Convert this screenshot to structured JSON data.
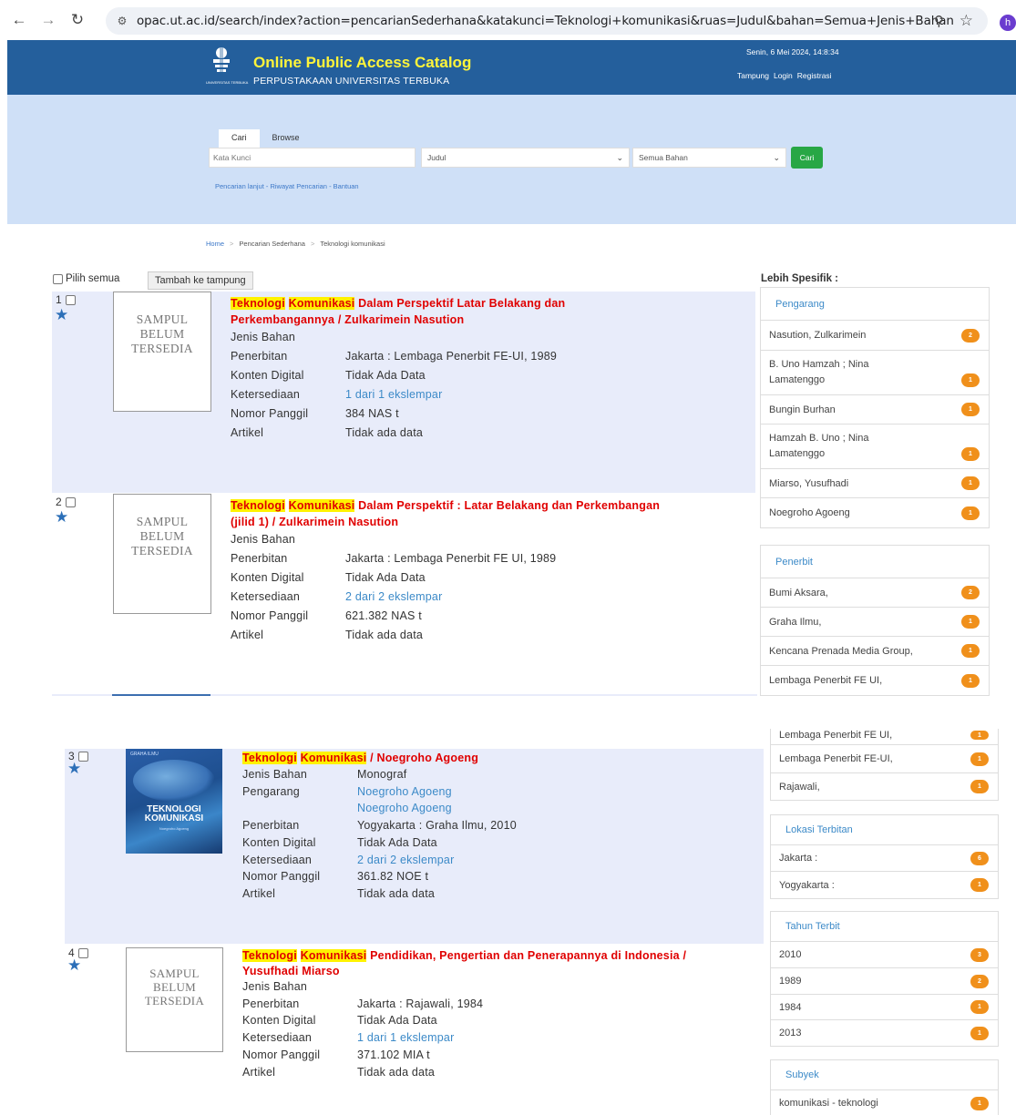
{
  "browser": {
    "url": "opac.ut.ac.id/search/index?action=pencarianSederhana&katakunci=Teknologi+komunikasi&ruas=Judul&bahan=Semua+Jenis+Bahan",
    "profile_initial": "h"
  },
  "header": {
    "title": "Online Public Access Catalog",
    "subtitle": "PERPUSTAKAAN UNIVERSITAS TERBUKA",
    "logo_text": "UNIVERSITAS TERBUKA",
    "date": "Senin, 6 Mei 2024, 14:8:34",
    "links": [
      "Tampung",
      "Login",
      "Registrasi"
    ]
  },
  "search": {
    "tabs": [
      "Cari",
      "Browse"
    ],
    "keyword_placeholder": "Kata Kunci",
    "field_value": "Judul",
    "material_value": "Semua Bahan",
    "button": "Cari",
    "links": "Pencarian lanjut - Riwayat Pencarian - Bantuan"
  },
  "breadcrumb": [
    "Home",
    "Pencarian Sederhana",
    "Teknologi komunikasi"
  ],
  "toolbar": {
    "select_all": "Pilih semua",
    "add_button": "Tambah ke tampung"
  },
  "placeholder_cover": [
    "SAMPUL",
    "BELUM",
    "TERSEDIA"
  ],
  "results": [
    {
      "num": "1",
      "title_hl1": "Teknologi",
      "title_hl2": "Komunikasi",
      "title_rest": "Dalam Perspektif Latar Belakang dan Perkembangannya / Zulkarimein Nasution",
      "fields": [
        {
          "k": "Jenis Bahan",
          "v": ""
        },
        {
          "k": "Penerbitan",
          "v": "Jakarta : Lembaga Penerbit FE-UI, 1989"
        },
        {
          "k": "Konten Digital",
          "v": "Tidak Ada Data"
        },
        {
          "k": "Ketersediaan",
          "v": "1 dari 1 ekslempar"
        },
        {
          "k": "Nomor Panggil",
          "v": "384 NAS t"
        },
        {
          "k": "Artikel",
          "v": "Tidak ada data"
        }
      ]
    },
    {
      "num": "2",
      "title_hl1": "Teknologi",
      "title_hl2": "Komunikasi",
      "title_rest": "Dalam Perspektif : Latar Belakang dan Perkembangan (jilid 1) / Zulkarimein Nasution",
      "fields": [
        {
          "k": "Jenis Bahan",
          "v": ""
        },
        {
          "k": "Penerbitan",
          "v": "Jakarta : Lembaga Penerbit FE UI, 1989"
        },
        {
          "k": "Konten Digital",
          "v": "Tidak Ada Data"
        },
        {
          "k": "Ketersediaan",
          "v": "2 dari 2 ekslempar"
        },
        {
          "k": "Nomor Panggil",
          "v": "621.382 NAS t"
        },
        {
          "k": "Artikel",
          "v": "Tidak ada data"
        }
      ]
    },
    {
      "num": "3",
      "title_hl1": "Teknologi",
      "title_hl2": "Komunikasi",
      "title_rest": "/ Noegroho Agoeng",
      "cover": {
        "publisher": "GRAHA ILMU",
        "title_line1": "TEKNOLOGI",
        "title_line2": "KOMUNIKASI",
        "author": "Noegroho Agoeng"
      },
      "fields": [
        {
          "k": "Jenis Bahan",
          "v": "Monograf"
        },
        {
          "k": "Pengarang",
          "v": "Noegroho Agoeng"
        },
        {
          "k": "",
          "v": "Noegroho Agoeng"
        },
        {
          "k": "Penerbitan",
          "v": "Yogyakarta : Graha Ilmu, 2010"
        },
        {
          "k": "Konten Digital",
          "v": "Tidak Ada Data"
        },
        {
          "k": "Ketersediaan",
          "v": "2 dari 2 ekslempar"
        },
        {
          "k": "Nomor Panggil",
          "v": "361.82 NOE t"
        },
        {
          "k": "Artikel",
          "v": "Tidak ada data"
        }
      ]
    },
    {
      "num": "4",
      "title_hl1": "Teknologi",
      "title_hl2": "Komunikasi",
      "title_rest": "Pendidikan, Pengertian dan Penerapannya di Indonesia / Yusufhadi Miarso",
      "fields": [
        {
          "k": "Jenis Bahan",
          "v": ""
        },
        {
          "k": "Penerbitan",
          "v": "Jakarta : Rajawali, 1984"
        },
        {
          "k": "Konten Digital",
          "v": "Tidak Ada Data"
        },
        {
          "k": "Ketersediaan",
          "v": "1 dari 1 ekslempar"
        },
        {
          "k": "Nomor Panggil",
          "v": "371.102 MIA t"
        },
        {
          "k": "Artikel",
          "v": "Tidak ada data"
        }
      ]
    }
  ],
  "sidebar": {
    "heading": "Lebih Spesifik :",
    "pengarang": {
      "title": "Pengarang",
      "items": [
        {
          "label": "Nasution, Zulkarimein",
          "count": "2"
        },
        {
          "label": "B. Uno Hamzah ; Nina Lamatenggo",
          "count": "1"
        },
        {
          "label": "Bungin Burhan",
          "count": "1"
        },
        {
          "label": "Hamzah B. Uno ; Nina Lamatenggo",
          "count": "1"
        },
        {
          "label": "Miarso, Yusufhadi",
          "count": "1"
        },
        {
          "label": "Noegroho Agoeng",
          "count": "1"
        }
      ]
    },
    "penerbit": {
      "title": "Penerbit",
      "items": [
        {
          "label": "Bumi Aksara,",
          "count": "2"
        },
        {
          "label": "Graha Ilmu,",
          "count": "1"
        },
        {
          "label": "Kencana Prenada Media Group,",
          "count": "1"
        },
        {
          "label": "Lembaga Penerbit FE UI,",
          "count": "1"
        }
      ],
      "items_cont": [
        {
          "label": "Lembaga Penerbit FE UI,",
          "count": "1"
        },
        {
          "label": "Lembaga Penerbit FE-UI,",
          "count": "1"
        },
        {
          "label": "Rajawali,",
          "count": "1"
        }
      ]
    },
    "lokasi": {
      "title": "Lokasi Terbitan",
      "items": [
        {
          "label": "Jakarta :",
          "count": "6"
        },
        {
          "label": "Yogyakarta :",
          "count": "1"
        }
      ]
    },
    "tahun": {
      "title": "Tahun Terbit",
      "items": [
        {
          "label": "2010",
          "count": "3"
        },
        {
          "label": "1989",
          "count": "2"
        },
        {
          "label": "1984",
          "count": "1"
        },
        {
          "label": "2013",
          "count": "1"
        }
      ]
    },
    "subyek": {
      "title": "Subyek",
      "items": [
        {
          "label": "komunikasi - teknologi",
          "count": "1"
        }
      ]
    }
  },
  "colors": {
    "header_bg": "#245f9c",
    "search_bg": "#cfe0f7",
    "title_red": "#e00000",
    "highlight": "#fff200",
    "badge": "#f0901b",
    "link": "#3c8ac8"
  }
}
